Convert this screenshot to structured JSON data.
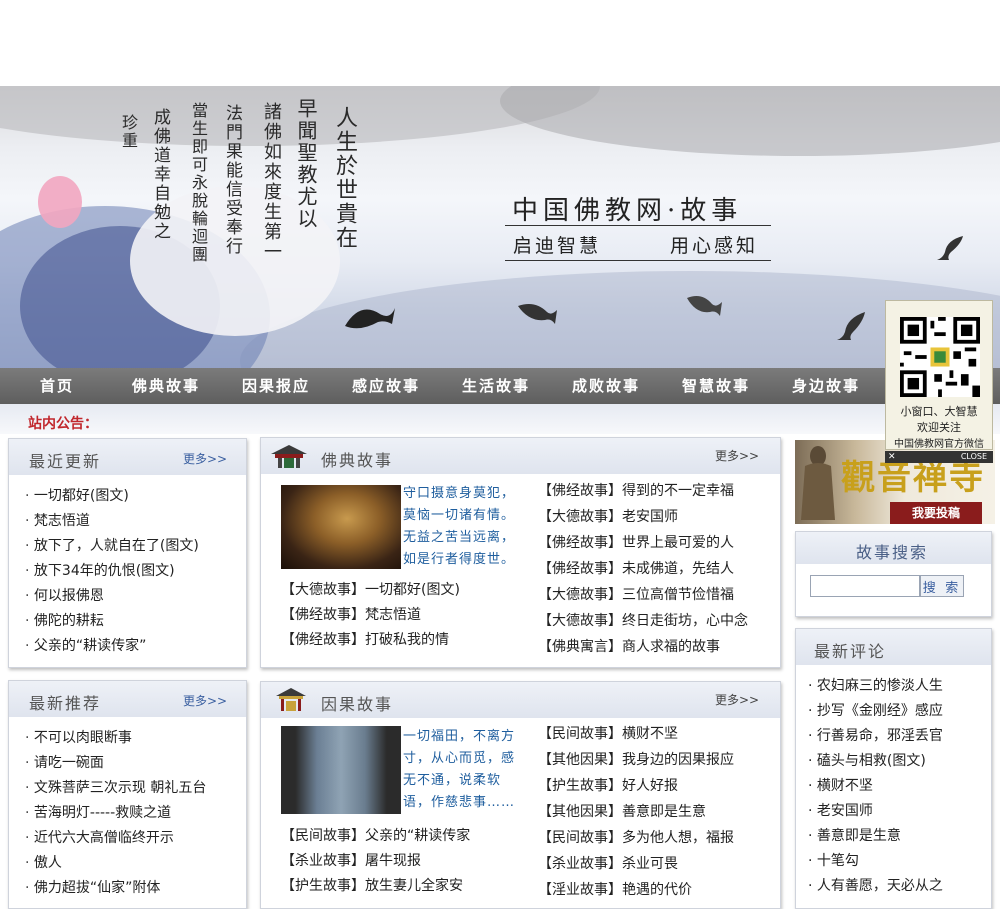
{
  "banner": {
    "site_title": "中国佛教网·故事",
    "slogan_left": "启迪智慧",
    "slogan_right": "用心感知",
    "calligraphy": [
      "人生於世貴在",
      "早聞聖教尤以",
      "諸佛如來度生第一",
      "法門果能信受奉行",
      "當生即可永脫輪迴團",
      "成佛道幸自勉之",
      "珍重"
    ]
  },
  "nav": {
    "items": [
      "首页",
      "佛典故事",
      "因果报应",
      "感应故事",
      "生活故事",
      "成败故事",
      "智慧故事",
      "身边故事"
    ]
  },
  "notice": {
    "label": "站内公告："
  },
  "recent": {
    "title": "最近更新",
    "more": "更多>>",
    "items": [
      "一切都好(图文)",
      "梵志悟道",
      "放下了，人就自在了(图文)",
      "放下34年的仇恨(图文)",
      "何以报佛恩",
      "佛陀的耕耘",
      "父亲的“耕读传家”"
    ]
  },
  "recommend": {
    "title": "最新推荐",
    "more": "更多>>",
    "items": [
      "不可以肉眼断事",
      "请吃一碗面",
      "文殊菩萨三次示现 朝礼五台",
      "苦海明灯-----救赎之道",
      "近代六大高僧临终开示",
      "傲人",
      "佛力超拔“仙家”附体"
    ]
  },
  "fodian": {
    "title": "佛典故事",
    "more": "更多>>",
    "intro": "守口摄意身莫犯，莫恼一切诸有情。无益之苦当远离，如是行者得度世。",
    "left_items": [
      "【大德故事】一切都好(图文)",
      "【佛经故事】梵志悟道",
      "【佛经故事】打破私我的情"
    ],
    "right_items": [
      "【佛经故事】得到的不一定幸福",
      "【大德故事】老安国师",
      "【佛经故事】世界上最可爱的人",
      "【佛经故事】未成佛道，先结人",
      "【大德故事】三位高僧节俭惜福",
      "【大德故事】终日走街坊，心中念",
      "【佛典寓言】商人求福的故事"
    ]
  },
  "yinguo": {
    "title": "因果故事",
    "more": "更多>>",
    "intro": "一切福田，不离方寸，从心而觅，感无不通，说柔软语，作慈悲事……",
    "left_items": [
      "【民间故事】父亲的“耕读传家",
      "【杀业故事】屠牛现报",
      "【护生故事】放生妻儿全家安"
    ],
    "right_items": [
      "【民间故事】横财不坚",
      "【其他因果】我身边的因果报应",
      "【护生故事】好人好报",
      "【其他因果】善意即是生意",
      "【民间故事】多为他人想，福报",
      "【杀业故事】杀业可畏",
      "【淫业故事】艳遇的代价"
    ]
  },
  "search": {
    "title": "故事搜索",
    "button": "搜 索",
    "value": ""
  },
  "comments": {
    "title": "最新评论",
    "items": [
      "· 农妇麻三的惨淡人生",
      "· 抄写《金刚经》感应",
      "· 行善易命，邪淫丢官",
      "· 磕头与相救(图文)",
      "· 横财不坚",
      "· 老安国师",
      "· 善意即是生意",
      "· 十笔勾",
      "· 人有善愿，天必从之"
    ]
  },
  "qr_ad": {
    "line1": "小窗口、大智慧",
    "line2": "欢迎关注",
    "line3": "中国佛教网官方微信",
    "close": "CLOSE"
  },
  "guanyin_ad": {
    "title": "觀音禅寺",
    "button": "我要投稿"
  },
  "colors": {
    "nav_bg": "#6b6b6b",
    "notice_red": "#c1272d",
    "link_blue": "#3a5fa0"
  }
}
